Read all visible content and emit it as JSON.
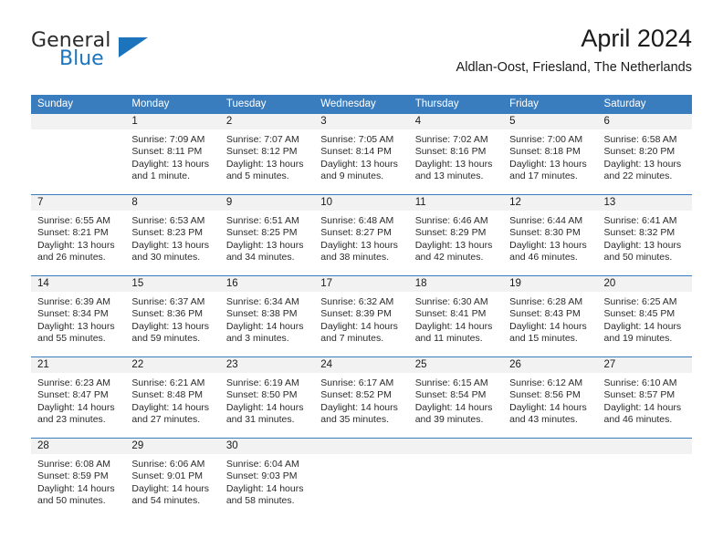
{
  "brand": {
    "name_part1": "General",
    "name_part2": "Blue"
  },
  "header": {
    "month_title": "April 2024",
    "location": "Aldlan-Oost, Friesland, The Netherlands"
  },
  "colors": {
    "header_blue": "#3a7dbf",
    "brand_blue": "#1c75bc",
    "daynum_band": "#f2f2f2",
    "text": "#2a2a2a"
  },
  "weekdays": [
    "Sunday",
    "Monday",
    "Tuesday",
    "Wednesday",
    "Thursday",
    "Friday",
    "Saturday"
  ],
  "weeks": [
    [
      {
        "day": "",
        "sunrise": "",
        "sunset": "",
        "daylight": "",
        "empty": true
      },
      {
        "day": "1",
        "sunrise": "Sunrise: 7:09 AM",
        "sunset": "Sunset: 8:11 PM",
        "daylight": "Daylight: 13 hours and 1 minute."
      },
      {
        "day": "2",
        "sunrise": "Sunrise: 7:07 AM",
        "sunset": "Sunset: 8:12 PM",
        "daylight": "Daylight: 13 hours and 5 minutes."
      },
      {
        "day": "3",
        "sunrise": "Sunrise: 7:05 AM",
        "sunset": "Sunset: 8:14 PM",
        "daylight": "Daylight: 13 hours and 9 minutes."
      },
      {
        "day": "4",
        "sunrise": "Sunrise: 7:02 AM",
        "sunset": "Sunset: 8:16 PM",
        "daylight": "Daylight: 13 hours and 13 minutes."
      },
      {
        "day": "5",
        "sunrise": "Sunrise: 7:00 AM",
        "sunset": "Sunset: 8:18 PM",
        "daylight": "Daylight: 13 hours and 17 minutes."
      },
      {
        "day": "6",
        "sunrise": "Sunrise: 6:58 AM",
        "sunset": "Sunset: 8:20 PM",
        "daylight": "Daylight: 13 hours and 22 minutes."
      }
    ],
    [
      {
        "day": "7",
        "sunrise": "Sunrise: 6:55 AM",
        "sunset": "Sunset: 8:21 PM",
        "daylight": "Daylight: 13 hours and 26 minutes."
      },
      {
        "day": "8",
        "sunrise": "Sunrise: 6:53 AM",
        "sunset": "Sunset: 8:23 PM",
        "daylight": "Daylight: 13 hours and 30 minutes."
      },
      {
        "day": "9",
        "sunrise": "Sunrise: 6:51 AM",
        "sunset": "Sunset: 8:25 PM",
        "daylight": "Daylight: 13 hours and 34 minutes."
      },
      {
        "day": "10",
        "sunrise": "Sunrise: 6:48 AM",
        "sunset": "Sunset: 8:27 PM",
        "daylight": "Daylight: 13 hours and 38 minutes."
      },
      {
        "day": "11",
        "sunrise": "Sunrise: 6:46 AM",
        "sunset": "Sunset: 8:29 PM",
        "daylight": "Daylight: 13 hours and 42 minutes."
      },
      {
        "day": "12",
        "sunrise": "Sunrise: 6:44 AM",
        "sunset": "Sunset: 8:30 PM",
        "daylight": "Daylight: 13 hours and 46 minutes."
      },
      {
        "day": "13",
        "sunrise": "Sunrise: 6:41 AM",
        "sunset": "Sunset: 8:32 PM",
        "daylight": "Daylight: 13 hours and 50 minutes."
      }
    ],
    [
      {
        "day": "14",
        "sunrise": "Sunrise: 6:39 AM",
        "sunset": "Sunset: 8:34 PM",
        "daylight": "Daylight: 13 hours and 55 minutes."
      },
      {
        "day": "15",
        "sunrise": "Sunrise: 6:37 AM",
        "sunset": "Sunset: 8:36 PM",
        "daylight": "Daylight: 13 hours and 59 minutes."
      },
      {
        "day": "16",
        "sunrise": "Sunrise: 6:34 AM",
        "sunset": "Sunset: 8:38 PM",
        "daylight": "Daylight: 14 hours and 3 minutes."
      },
      {
        "day": "17",
        "sunrise": "Sunrise: 6:32 AM",
        "sunset": "Sunset: 8:39 PM",
        "daylight": "Daylight: 14 hours and 7 minutes."
      },
      {
        "day": "18",
        "sunrise": "Sunrise: 6:30 AM",
        "sunset": "Sunset: 8:41 PM",
        "daylight": "Daylight: 14 hours and 11 minutes."
      },
      {
        "day": "19",
        "sunrise": "Sunrise: 6:28 AM",
        "sunset": "Sunset: 8:43 PM",
        "daylight": "Daylight: 14 hours and 15 minutes."
      },
      {
        "day": "20",
        "sunrise": "Sunrise: 6:25 AM",
        "sunset": "Sunset: 8:45 PM",
        "daylight": "Daylight: 14 hours and 19 minutes."
      }
    ],
    [
      {
        "day": "21",
        "sunrise": "Sunrise: 6:23 AM",
        "sunset": "Sunset: 8:47 PM",
        "daylight": "Daylight: 14 hours and 23 minutes."
      },
      {
        "day": "22",
        "sunrise": "Sunrise: 6:21 AM",
        "sunset": "Sunset: 8:48 PM",
        "daylight": "Daylight: 14 hours and 27 minutes."
      },
      {
        "day": "23",
        "sunrise": "Sunrise: 6:19 AM",
        "sunset": "Sunset: 8:50 PM",
        "daylight": "Daylight: 14 hours and 31 minutes."
      },
      {
        "day": "24",
        "sunrise": "Sunrise: 6:17 AM",
        "sunset": "Sunset: 8:52 PM",
        "daylight": "Daylight: 14 hours and 35 minutes."
      },
      {
        "day": "25",
        "sunrise": "Sunrise: 6:15 AM",
        "sunset": "Sunset: 8:54 PM",
        "daylight": "Daylight: 14 hours and 39 minutes."
      },
      {
        "day": "26",
        "sunrise": "Sunrise: 6:12 AM",
        "sunset": "Sunset: 8:56 PM",
        "daylight": "Daylight: 14 hours and 43 minutes."
      },
      {
        "day": "27",
        "sunrise": "Sunrise: 6:10 AM",
        "sunset": "Sunset: 8:57 PM",
        "daylight": "Daylight: 14 hours and 46 minutes."
      }
    ],
    [
      {
        "day": "28",
        "sunrise": "Sunrise: 6:08 AM",
        "sunset": "Sunset: 8:59 PM",
        "daylight": "Daylight: 14 hours and 50 minutes."
      },
      {
        "day": "29",
        "sunrise": "Sunrise: 6:06 AM",
        "sunset": "Sunset: 9:01 PM",
        "daylight": "Daylight: 14 hours and 54 minutes."
      },
      {
        "day": "30",
        "sunrise": "Sunrise: 6:04 AM",
        "sunset": "Sunset: 9:03 PM",
        "daylight": "Daylight: 14 hours and 58 minutes."
      },
      {
        "day": "",
        "sunrise": "",
        "sunset": "",
        "daylight": "",
        "empty": true
      },
      {
        "day": "",
        "sunrise": "",
        "sunset": "",
        "daylight": "",
        "empty": true
      },
      {
        "day": "",
        "sunrise": "",
        "sunset": "",
        "daylight": "",
        "empty": true
      },
      {
        "day": "",
        "sunrise": "",
        "sunset": "",
        "daylight": "",
        "empty": true
      }
    ]
  ]
}
